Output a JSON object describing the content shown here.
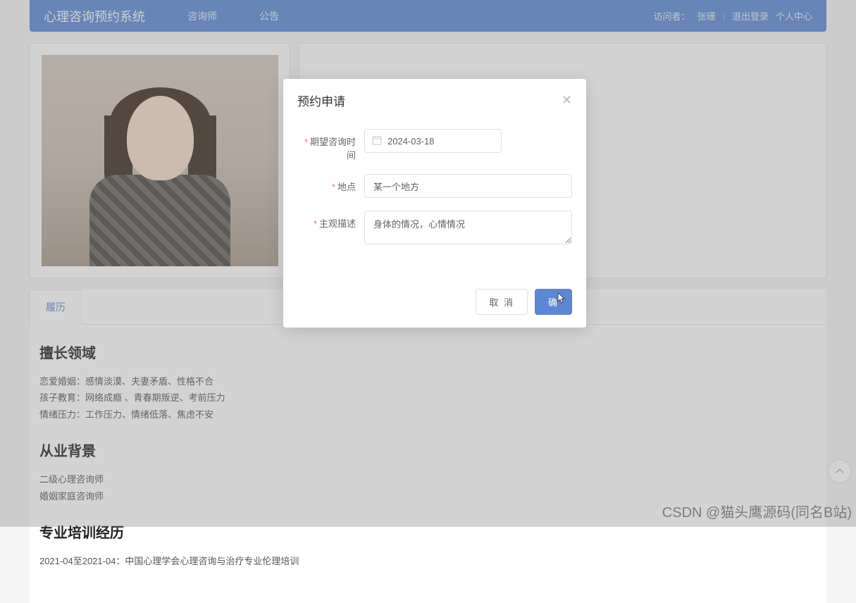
{
  "header": {
    "title": "心理咨询预约系统",
    "nav": [
      "咨询师",
      "公告"
    ],
    "visitor_label": "访问者：",
    "visitor_name": "张珊",
    "logout": "退出登录",
    "profile": "个人中心"
  },
  "tabs": {
    "items": [
      "履历"
    ]
  },
  "resume": {
    "s1_title": "擅长领域",
    "s1_body": "恋爱婚姻：感情淡漠、夫妻矛盾、性格不合\n孩子教育：网络成瘾 、青春期叛逆、考前压力\n情绪压力：工作压力、情绪低落、焦虑不安",
    "s2_title": "从业背景",
    "s2_body": "二级心理咨询师\n婚姻家庭咨询师",
    "s3_title": "专业培训经历",
    "s3_body": "2021-04至2021-04：中国心理学会心理咨询与治疗专业伦理培训"
  },
  "modal": {
    "title": "预约申请",
    "fields": {
      "date_label": "期望咨询时间",
      "date_value": "2024-03-18",
      "location_label": "地点",
      "location_value": "某一个地方",
      "desc_label": "主观描述",
      "desc_value": "身体的情况，心情情况"
    },
    "cancel": "取 消",
    "confirm": "确"
  },
  "watermark": "CSDN @猫头鹰源码(同名B站)"
}
